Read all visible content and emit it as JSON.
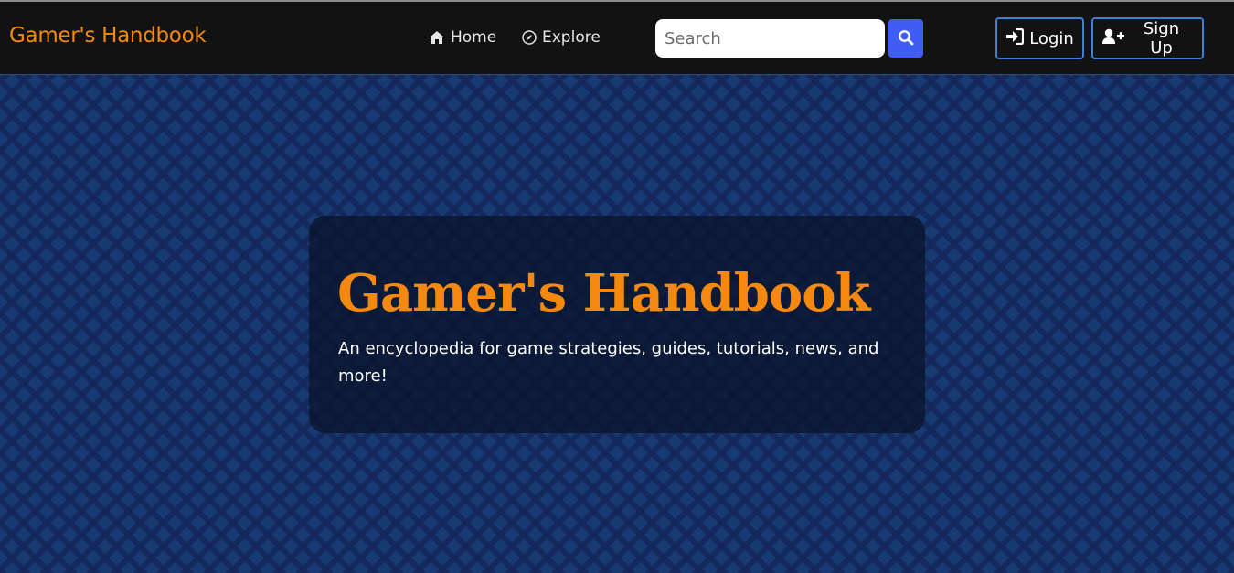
{
  "navbar": {
    "brand": "Gamer's Handbook",
    "links": [
      {
        "label": "Home",
        "icon": "home-icon"
      },
      {
        "label": "Explore",
        "icon": "compass-icon"
      }
    ],
    "search": {
      "placeholder": "Search",
      "value": "",
      "button_icon": "search-icon"
    },
    "login_label": "Login",
    "signup_label": "Sign Up"
  },
  "hero": {
    "title": "Gamer's Handbook",
    "subtitle": "An encyclopedia for game strategies, guides, tutorials, news, and more!"
  },
  "colors": {
    "accent": "#f5890f",
    "navbar_bg": "#121212",
    "search_button": "#3f5cf5",
    "auth_border": "#3f7fd6",
    "page_bg": "#173a73"
  }
}
